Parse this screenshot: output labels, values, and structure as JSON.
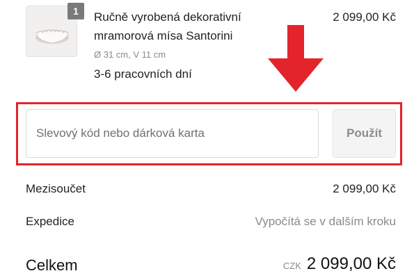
{
  "product": {
    "quantity": "1",
    "name_line1": "Ručně vyrobená dekorativní",
    "name_line2": "mramorová mísa Santorini",
    "variant": "Ø 31 cm, V 11 cm",
    "delivery": "3-6 pracovních dní",
    "price": "2 099,00 Kč",
    "image_icon": "marble-bowl-image"
  },
  "discount": {
    "placeholder": "Slevový kód nebo dárková karta",
    "value": "",
    "apply_label": "Použít"
  },
  "summary": {
    "subtotal_label": "Mezisoučet",
    "subtotal_value": "2 099,00 Kč",
    "shipping_label": "Expedice",
    "shipping_value": "Vypočítá se v dalším kroku",
    "total_label": "Celkem",
    "currency_code": "CZK",
    "total_value": "2 099,00 Kč"
  },
  "annotation": {
    "highlight_color": "#e3242b",
    "arrow_icon": "arrow-down-icon"
  }
}
